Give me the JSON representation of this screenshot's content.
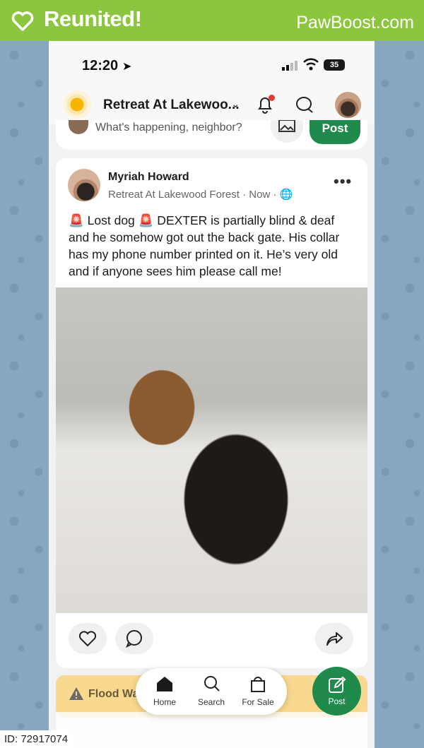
{
  "banner": {
    "title": "Reunited!",
    "brand": "PawBoost.com",
    "color": "#8cc63e"
  },
  "status_bar": {
    "time": "12:20",
    "battery": "35"
  },
  "app_bar": {
    "neighborhood": "Retreat At Lakewoo...",
    "icons": [
      "bell-icon",
      "chat-icon"
    ]
  },
  "compose": {
    "placeholder": "What's happening, neighbor?",
    "post_label": "Post"
  },
  "post": {
    "author": "Myriah Howard",
    "meta": "Retreat At Lakewood Forest · Now · ",
    "body": "🚨 Lost dog 🚨 DEXTER is partially blind & deaf and he somehow got out the back gate. His collar has my phone number printed on it. He’s very old and if anyone sees him please call me!"
  },
  "alert": {
    "text": "Flood Wa"
  },
  "nav": {
    "home": "Home",
    "search": "Search",
    "for_sale": "For Sale",
    "post": "Post"
  },
  "id_tag": "ID: 72917074",
  "accent": "#1f8a4c"
}
